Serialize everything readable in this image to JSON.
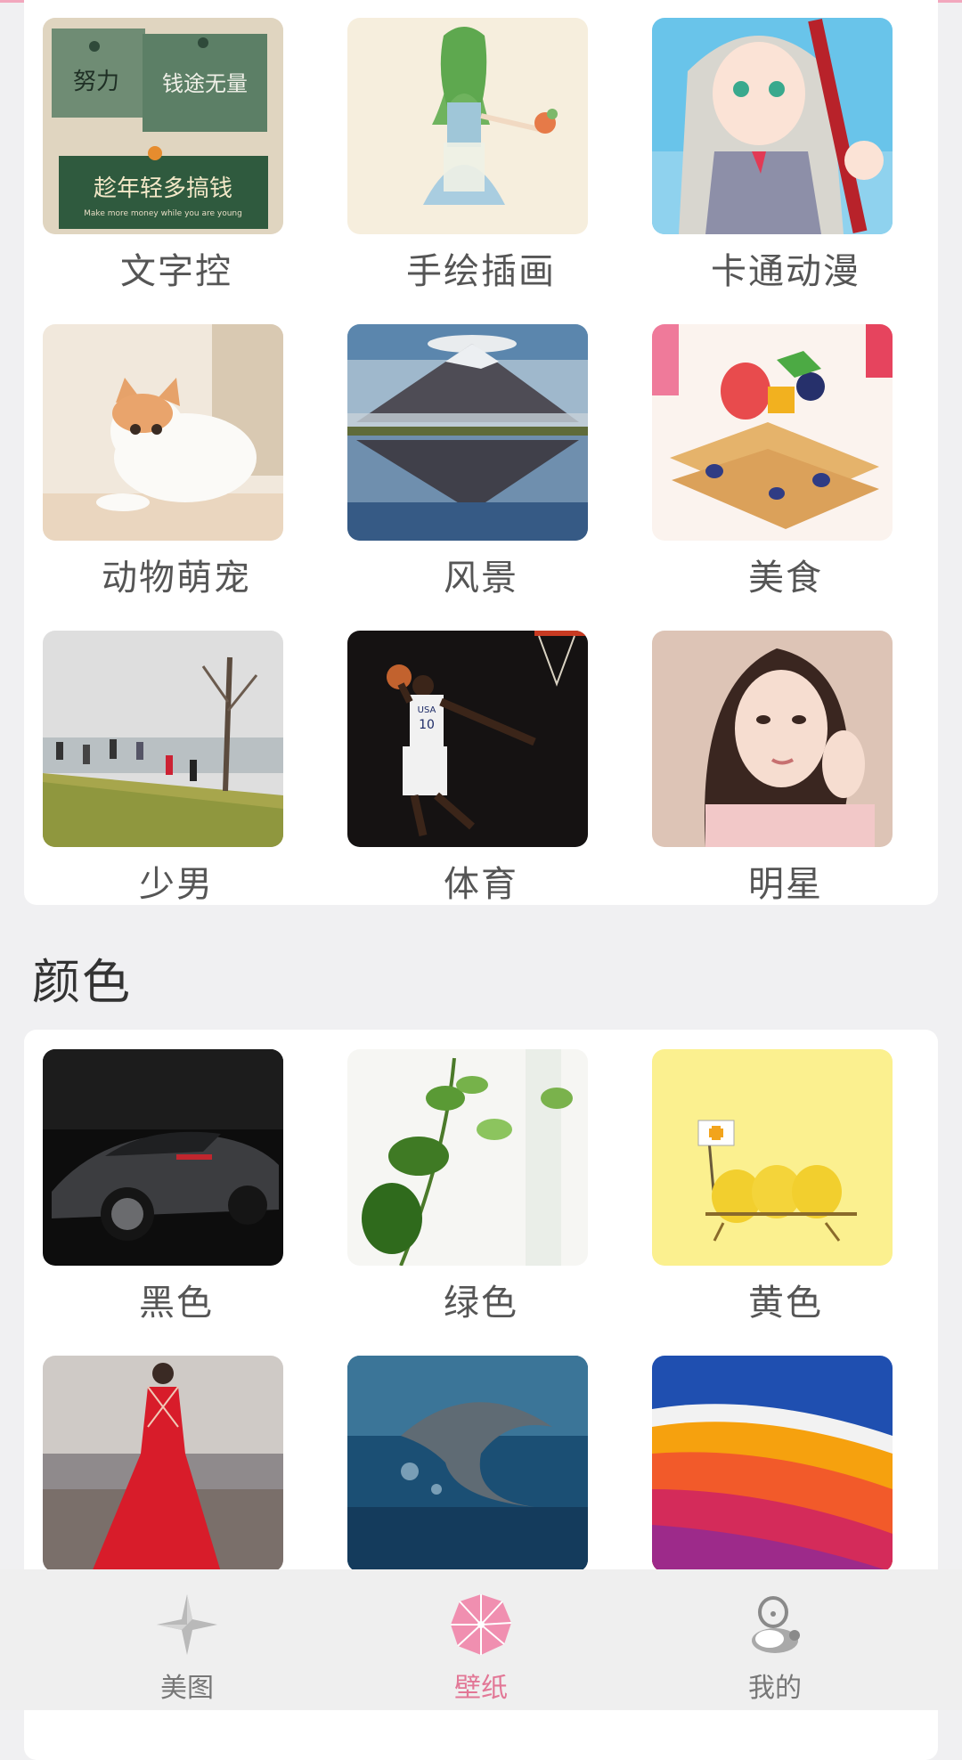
{
  "categories": [
    {
      "label": "文字控",
      "image": "motivational-text-notes"
    },
    {
      "label": "手绘插画",
      "image": "hand-drawn-girl-illustration"
    },
    {
      "label": "卡通动漫",
      "image": "anime-girl"
    },
    {
      "label": "动物萌宠",
      "image": "kitten"
    },
    {
      "label": "风景",
      "image": "mountain-lake-reflection"
    },
    {
      "label": "美食",
      "image": "fruit-pastry"
    },
    {
      "label": "少男",
      "image": "friends-jumping-on-hill"
    },
    {
      "label": "体育",
      "image": "basketball-dunk"
    },
    {
      "label": "明星",
      "image": "actress-portrait"
    }
  ],
  "notes_text": {
    "n1": "努力",
    "n2": "钱途无量",
    "n3": "趁年轻多搞钱",
    "n3_sub": "Make more money while you are young"
  },
  "jersey": {
    "team": "USA",
    "number": "10"
  },
  "color_section": {
    "title": "颜色",
    "items": [
      {
        "label": "黑色",
        "image": "black-sports-car"
      },
      {
        "label": "绿色",
        "image": "green-plant"
      },
      {
        "label": "黄色",
        "image": "yellow-cartoon-lemons"
      },
      {
        "label": "",
        "image": "red-dress-woman"
      },
      {
        "label": "",
        "image": "dolphin-jumping"
      },
      {
        "label": "",
        "image": "colorful-waves"
      }
    ]
  },
  "tabs": [
    {
      "label": "美图",
      "icon": "diamond-star-icon",
      "active": false
    },
    {
      "label": "壁纸",
      "icon": "umbrella-icon",
      "active": true
    },
    {
      "label": "我的",
      "icon": "profile-icon",
      "active": false
    }
  ],
  "colors": {
    "accent": "#e27796",
    "accent_light": "#f2a7bd"
  }
}
